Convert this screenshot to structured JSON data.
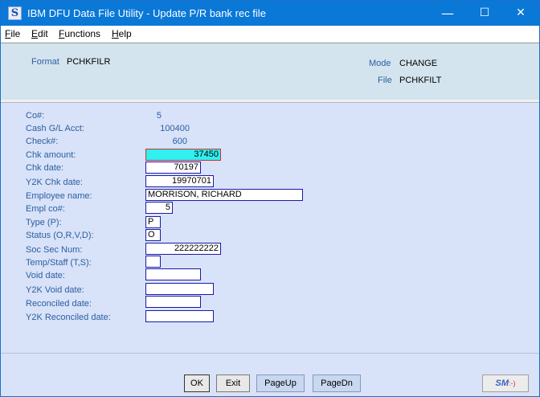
{
  "window": {
    "title": "IBM DFU Data File Utility - Update P/R bank rec file",
    "icon_letter": "S",
    "controls": {
      "minimize": "—",
      "maximize": "☐",
      "close": "✕"
    }
  },
  "menu": [
    {
      "label": "File",
      "mnemonic": "F",
      "rest": "ile"
    },
    {
      "label": "Edit",
      "mnemonic": "E",
      "rest": "dit"
    },
    {
      "label": "Functions",
      "mnemonic": "F",
      "rest": "unctions"
    },
    {
      "label": "Help",
      "mnemonic": "H",
      "rest": "elp"
    }
  ],
  "header": {
    "format_label": "Format",
    "format_value": "PCHKFILR",
    "mode_label": "Mode",
    "mode_value": "CHANGE",
    "file_label": "File",
    "file_value": "PCHKFILT"
  },
  "keys": [
    {
      "label": "Co#:",
      "value": "5"
    },
    {
      "label": "Cash G/L Acct:",
      "value": "100400"
    },
    {
      "label": "Check#:",
      "value": "600"
    }
  ],
  "fields": [
    {
      "label": "Chk amount:",
      "value": "37450"
    },
    {
      "label": "Chk date:",
      "value": "70197"
    },
    {
      "label": "Y2K Chk date:",
      "value": "19970701"
    },
    {
      "label": "Employee name:",
      "value": "MORRISON, RICHARD"
    },
    {
      "label": "Empl co#:",
      "value": "5"
    },
    {
      "label": "Type (P):",
      "value": "P"
    },
    {
      "label": "Status (O,R,V,D):",
      "value": "O"
    },
    {
      "label": "Soc Sec Num:",
      "value": "222222222"
    },
    {
      "label": "Temp/Staff (T,S):",
      "value": ""
    },
    {
      "label": "Void date:",
      "value": ""
    },
    {
      "label": "Y2K Void date:",
      "value": ""
    },
    {
      "label": "Reconciled date:",
      "value": ""
    },
    {
      "label": "Y2K Reconciled date:",
      "value": ""
    }
  ],
  "buttons": {
    "ok": "OK",
    "exit": "Exit",
    "page_up": "PageUp",
    "page_dn": "PageDn"
  },
  "logo": {
    "text": "SM",
    "face": ":-)"
  },
  "colors": {
    "titlebar": "#0a78d7",
    "active_field": "#30f0f0",
    "label_blue": "#2b5fa0"
  }
}
